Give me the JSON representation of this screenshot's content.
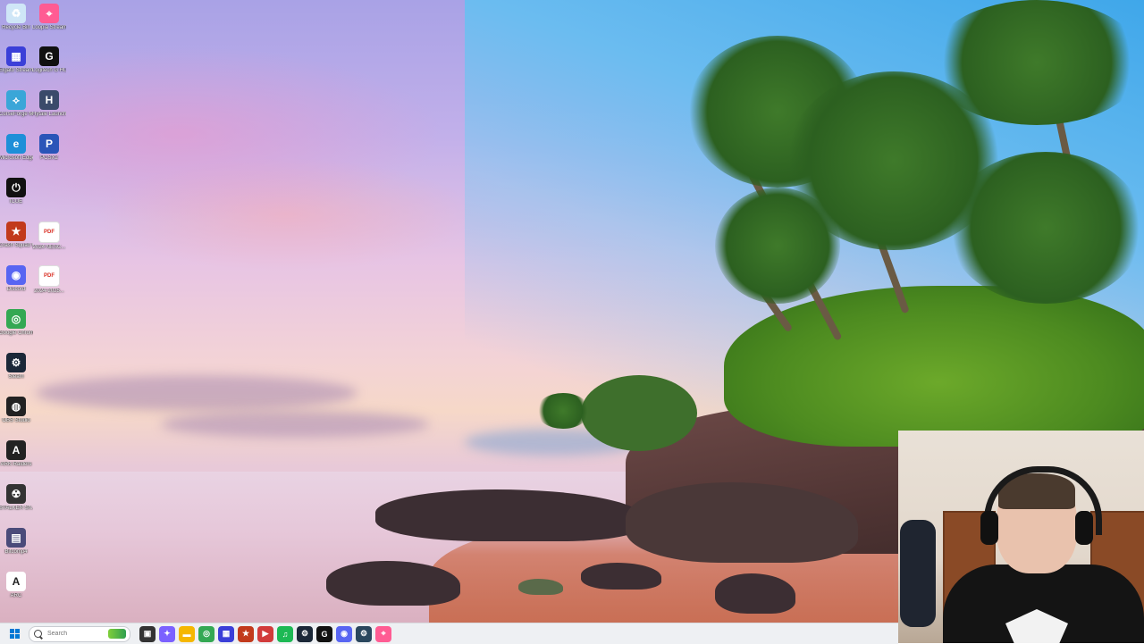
{
  "desktop_icons": [
    {
      "label": "Recycle Bin",
      "icon": "recycle-bin-icon",
      "color": "#cfe6f7",
      "glyph": "♻"
    },
    {
      "label": "Loopia Stream",
      "icon": "location-pin-icon",
      "color": "#ff5c93",
      "glyph": "⌖"
    },
    {
      "label": "Elgato Stream Deck",
      "icon": "stream-deck-icon",
      "color": "#3b3fd8",
      "glyph": "▦"
    },
    {
      "label": "Logitech G HUB",
      "icon": "logitech-g-icon",
      "color": "#111111",
      "glyph": "G"
    },
    {
      "label": "CurseForge MOD Manager",
      "icon": "curseforge-icon",
      "color": "#3aa6d8",
      "glyph": "⟡"
    },
    {
      "label": "Hytale Launcher",
      "icon": "hytale-icon",
      "color": "#3a4a6a",
      "glyph": "H"
    },
    {
      "label": "Microsoft Edge",
      "icon": "edge-icon",
      "color": "#1e8fd8",
      "glyph": "e"
    },
    {
      "label": "PCSX2",
      "icon": "pcsx2-icon",
      "color": "#2a55b8",
      "glyph": "P"
    },
    {
      "label": "ICUE",
      "icon": "icue-icon",
      "color": "#111111",
      "glyph": "⏻"
    },
    {
      "label": "Crash Squad Crapparamon",
      "icon": "game-icon",
      "color": "#c23a1c",
      "glyph": "★"
    },
    {
      "label": "2024 NESC...",
      "icon": "pdf-icon",
      "color": "#d93025",
      "glyph": "PDF"
    },
    {
      "label": "Discord",
      "icon": "discord-icon",
      "color": "#5865f2",
      "glyph": "◉"
    },
    {
      "label": "2024-2025...",
      "icon": "pdf-icon",
      "color": "#d93025",
      "glyph": "PDF"
    },
    {
      "label": "Google Chrome",
      "icon": "chrome-icon",
      "color": "#34a853",
      "glyph": "◎"
    },
    {
      "label": "Steam",
      "icon": "steam-icon",
      "color": "#1b2838",
      "glyph": "⚙"
    },
    {
      "label": "OBS Studio",
      "icon": "obs-icon",
      "color": "#222222",
      "glyph": "◍"
    },
    {
      "label": "ARK Raiders",
      "icon": "arc-raiders-icon",
      "color": "#222222",
      "glyph": "A"
    },
    {
      "label": "STALKER Sh... of Chern...",
      "icon": "stalker-icon",
      "color": "#333333",
      "glyph": "☢"
    },
    {
      "label": "Bitcomp4",
      "icon": "video-file-icon",
      "color": "#4b4b7a",
      "glyph": "▤"
    },
    {
      "label": "ARC",
      "icon": "arc-icon",
      "color": "#ffffff",
      "glyph": "A"
    }
  ],
  "taskbar": {
    "search_placeholder": "Search",
    "apps": [
      {
        "name": "task-view-icon",
        "color": "#333333",
        "glyph": "▣"
      },
      {
        "name": "copilot-icon",
        "color": "#7b61ff",
        "glyph": "✦"
      },
      {
        "name": "file-explorer-icon",
        "color": "#f5b700",
        "glyph": "▬"
      },
      {
        "name": "chrome-icon",
        "color": "#34a853",
        "glyph": "◎"
      },
      {
        "name": "stream-deck-icon",
        "color": "#3b3fd8",
        "glyph": "▦"
      },
      {
        "name": "game-icon",
        "color": "#c23a1c",
        "glyph": "★"
      },
      {
        "name": "media-icon",
        "color": "#d23b3b",
        "glyph": "▶"
      },
      {
        "name": "spotify-icon",
        "color": "#1db954",
        "glyph": "♫"
      },
      {
        "name": "steam-icon",
        "color": "#1b2838",
        "glyph": "⚙"
      },
      {
        "name": "logitech-g-icon",
        "color": "#111111",
        "glyph": "G"
      },
      {
        "name": "discord-icon",
        "color": "#5865f2",
        "glyph": "◉"
      },
      {
        "name": "steam-icon",
        "color": "#2a475e",
        "glyph": "⚙"
      },
      {
        "name": "location-pin-icon",
        "color": "#ff5c93",
        "glyph": "⌖"
      }
    ]
  },
  "colors": {
    "accent": "#0078d4",
    "taskbar_bg": "#eef0f3"
  }
}
